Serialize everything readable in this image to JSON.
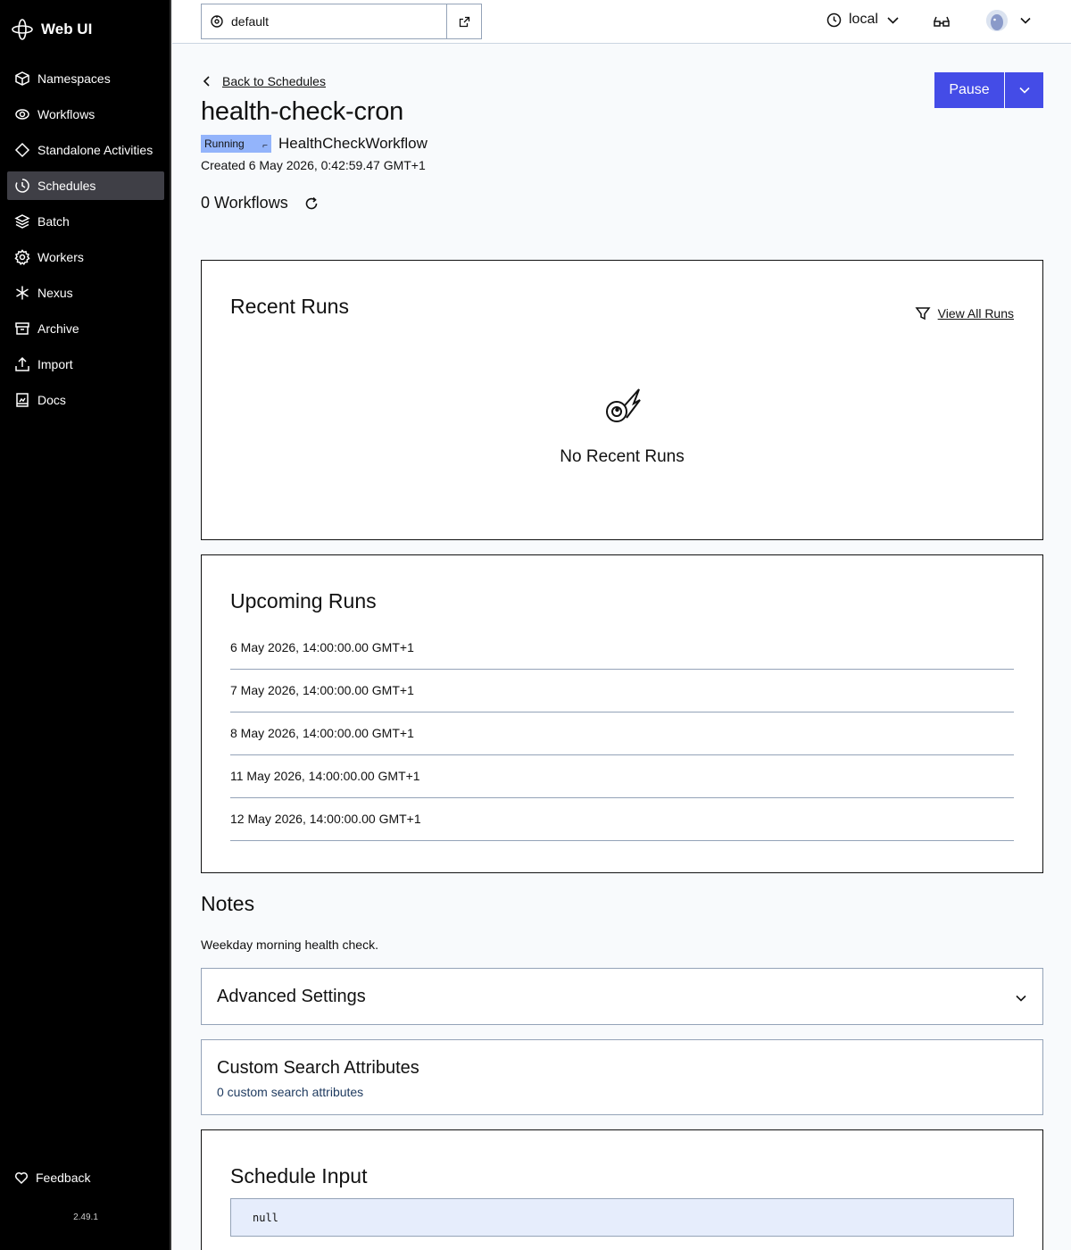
{
  "app": {
    "title": "Web UI",
    "version": "2.49.1",
    "feedback": "Feedback"
  },
  "sidebar": {
    "items": [
      {
        "label": "Namespaces",
        "icon": "cube-icon"
      },
      {
        "label": "Workflows",
        "icon": "workflows-icon"
      },
      {
        "label": "Standalone Activities",
        "icon": "diamond-icon"
      },
      {
        "label": "Schedules",
        "icon": "schedules-icon",
        "active": true
      },
      {
        "label": "Batch",
        "icon": "layers-icon"
      },
      {
        "label": "Workers",
        "icon": "gear-icon"
      },
      {
        "label": "Nexus",
        "icon": "nexus-icon"
      },
      {
        "label": "Archive",
        "icon": "archive-icon"
      },
      {
        "label": "Import",
        "icon": "upload-icon"
      },
      {
        "label": "Docs",
        "icon": "docs-icon"
      }
    ]
  },
  "topbar": {
    "namespace": "default",
    "timezone": "local"
  },
  "schedule": {
    "back_label": "Back to Schedules",
    "name": "health-check-cron",
    "status": "Running",
    "workflow_type": "HealthCheckWorkflow",
    "created": "Created 6 May 2026, 0:42:59.47 GMT+1",
    "workflow_count": "0 Workflows",
    "pause_label": "Pause"
  },
  "recent_runs": {
    "title": "Recent Runs",
    "view_all": "View All Runs",
    "empty": "No Recent Runs"
  },
  "upcoming_runs": {
    "title": "Upcoming Runs",
    "items": [
      "6 May 2026, 14:00:00.00 GMT+1",
      "7 May 2026, 14:00:00.00 GMT+1",
      "8 May 2026, 14:00:00.00 GMT+1",
      "11 May 2026, 14:00:00.00 GMT+1",
      "12 May 2026, 14:00:00.00 GMT+1"
    ]
  },
  "notes": {
    "title": "Notes",
    "text": "Weekday morning health check."
  },
  "advanced": {
    "title": "Advanced Settings"
  },
  "search_attributes": {
    "title": "Custom Search Attributes",
    "count_text": "0 custom search attributes"
  },
  "schedule_input": {
    "title": "Schedule Input",
    "value": "null"
  },
  "colors": {
    "accent": "#444ce7",
    "badge": "#93b4fb",
    "sidebar": "#000000",
    "code_bg": "#e6edfc"
  }
}
